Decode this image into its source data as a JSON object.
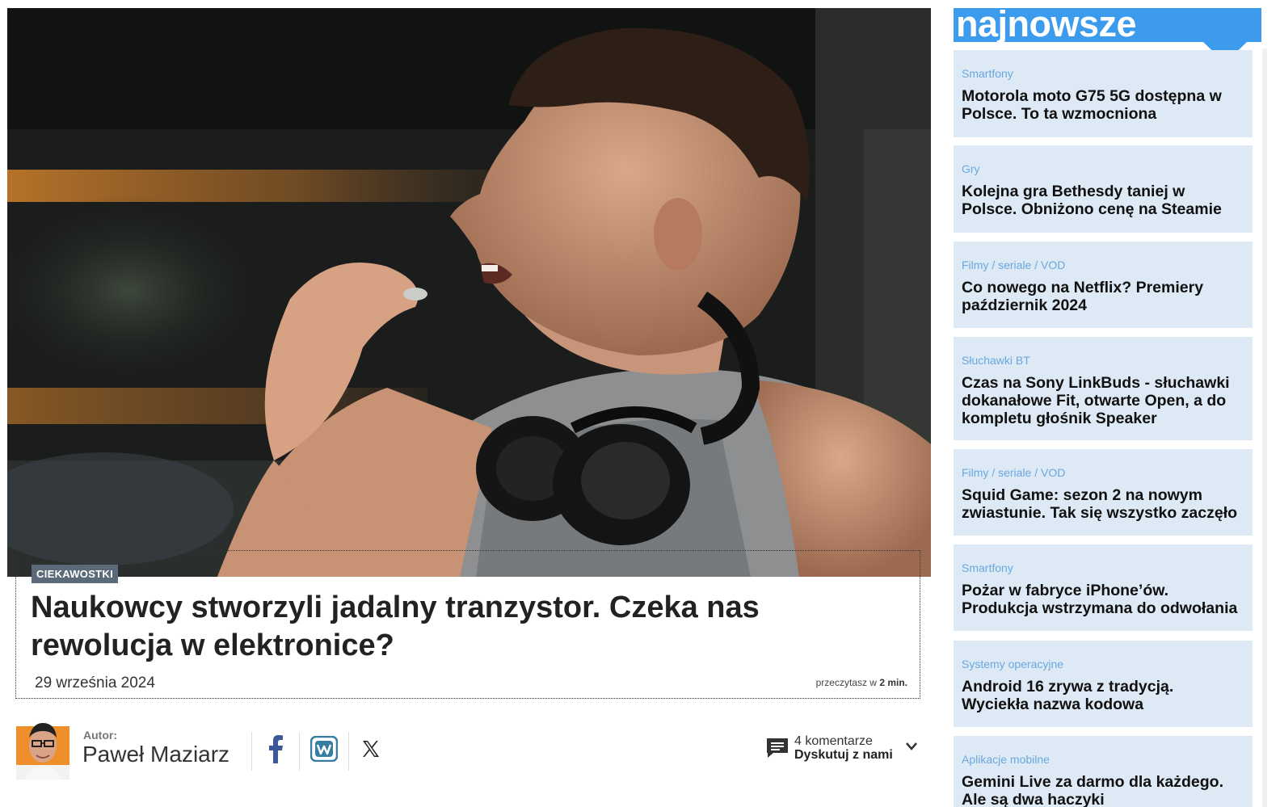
{
  "article": {
    "category": "CIEKAWOSTKI",
    "title": "Naukowcy stworzyli jadalny tranzystor. Czeka nas rewolucja w elektronice?",
    "date": "29 września 2024",
    "read_time_prefix": "przeczytasz w",
    "read_time_value": "2 min."
  },
  "author": {
    "label": "Autor:",
    "name": "Paweł Maziarz"
  },
  "share": {
    "facebook_icon": "facebook-icon",
    "wykop_icon": "wykop-icon",
    "x_icon": "x-icon"
  },
  "comments": {
    "count": "4 komentarze",
    "cta": "Dyskutuj z nami"
  },
  "sidebar": {
    "title": "najnowsze",
    "accent": "#3d9bee",
    "item_bg": "#dde9f5",
    "items": [
      {
        "category": "Smartfony",
        "title": "Motorola moto G75 5G dostępna w Polsce. To ta wzmocniona"
      },
      {
        "category": "Gry",
        "title": "Kolejna gra Bethesdy taniej w Polsce. Obniżono cenę na Steamie"
      },
      {
        "category": "Filmy / seriale / VOD",
        "title": "Co nowego na Netflix? Premiery październik 2024"
      },
      {
        "category": "Słuchawki BT",
        "title": "Czas na Sony LinkBuds - słuchawki dokanałowe Fit, otwarte Open, a do kompletu głośnik Speaker"
      },
      {
        "category": "Filmy / seriale / VOD",
        "title": "Squid Game: sezon 2 na nowym zwiastunie. Tak się wszystko zaczęło"
      },
      {
        "category": "Smartfony",
        "title": "Pożar w fabryce iPhone’ów. Produkcja wstrzymana do odwołania"
      },
      {
        "category": "Systemy operacyjne",
        "title": "Android 16 zrywa z tradycją. Wyciekła nazwa kodowa"
      },
      {
        "category": "Aplikacje mobilne",
        "title": "Gemini Live za darmo dla każdego. Ale są dwa haczyki"
      }
    ]
  }
}
